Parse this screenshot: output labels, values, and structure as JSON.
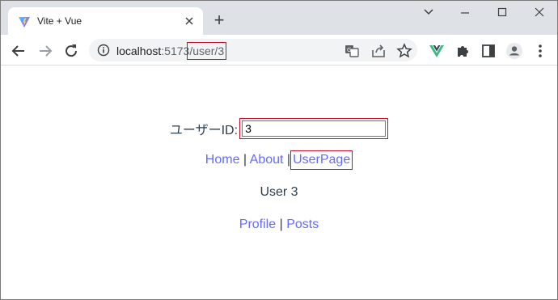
{
  "browser": {
    "tab_title": "Vite + Vue",
    "new_tab_label": "+",
    "url_host": "localhost",
    "url_port": ":5173",
    "url_path": "/user/3"
  },
  "page": {
    "userid_label": "ユーザーID:",
    "userid_value": "3",
    "nav": {
      "home": "Home",
      "about": "About",
      "userpage": "UserPage",
      "separator": "|"
    },
    "user_heading": "User 3",
    "subnav": {
      "profile": "Profile",
      "posts": "Posts",
      "separator": "|"
    }
  },
  "colors": {
    "link": "#646cff",
    "text": "#2c3e50",
    "highlight_box": "#c8102e",
    "tabstrip_bg": "#dee1e6",
    "vue_green": "#41b883"
  },
  "icons": {
    "tab_favicon": "vite-logo-icon",
    "close": "close-icon",
    "back": "back-arrow-icon",
    "forward": "forward-arrow-icon",
    "reload": "reload-icon",
    "info": "info-icon",
    "translate": "translate-icon",
    "share": "share-icon",
    "bookmark": "star-icon",
    "vue_devtools": "vue-logo-icon",
    "extensions": "puzzle-icon",
    "side_panel": "side-panel-icon",
    "profile": "avatar-icon",
    "menu": "kebab-menu-icon"
  }
}
